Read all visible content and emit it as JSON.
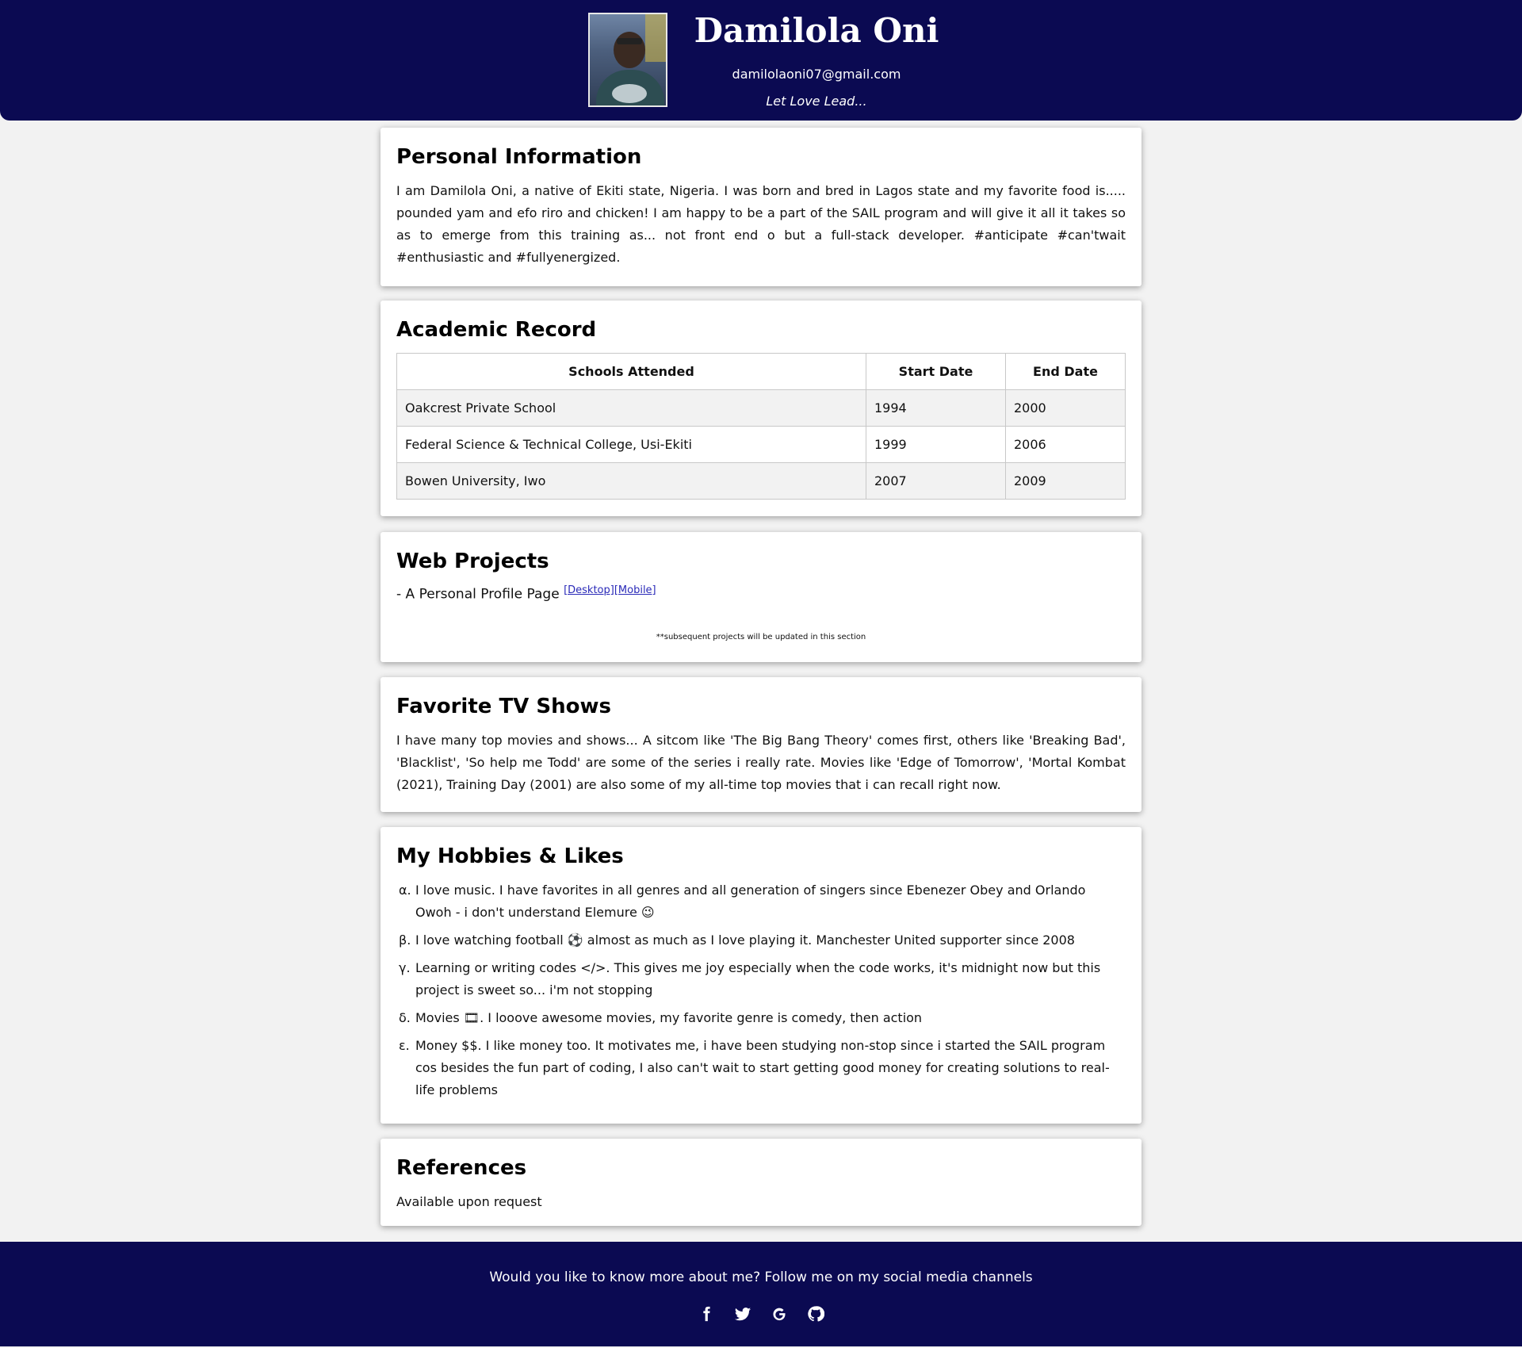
{
  "header": {
    "name": "Damilola Oni",
    "email": "damilolaoni07@gmail.com",
    "tagline": "Let Love Lead..."
  },
  "personal": {
    "title": "Personal Information",
    "text": "I am Damilola Oni, a native of Ekiti state, Nigeria. I was born and bred in Lagos state and my favorite food is..... pounded yam and efo riro and chicken! I am happy to be a part of the SAIL program and will give it all it takes so as to emerge from this training as... not front end o but a full-stack developer. #anticipate #can'twait #enthusiastic and #fullyenergized."
  },
  "academic": {
    "title": "Academic Record",
    "headers": [
      "Schools Attended",
      "Start Date",
      "End Date"
    ],
    "rows": [
      [
        "Oakcrest Private School",
        "1994",
        "2000"
      ],
      [
        "Federal Science & Technical College, Usi-Ekiti",
        "1999",
        "2006"
      ],
      [
        "Bowen University, Iwo",
        "2007",
        "2009"
      ]
    ]
  },
  "projects": {
    "title": "Web Projects",
    "item": "- A Personal Profile Page",
    "link_desktop": "[Desktop]",
    "link_mobile": "[Mobile]",
    "note": "**subsequent projects will be updated in this section"
  },
  "tvshows": {
    "title": "Favorite TV Shows",
    "text": "I have many top movies and shows... A sitcom like 'The Big Bang Theory' comes first, others like 'Breaking Bad', 'Blacklist', 'So help me Todd' are some of the series i really rate. Movies like 'Edge of Tomorrow', 'Mortal Kombat (2021), Training Day (2001) are also some of my all-time top movies that i can recall right now."
  },
  "hobbies": {
    "title": "My Hobbies & Likes",
    "items": [
      {
        "marker": "α.",
        "text": "I love music. I have favorites in all genres and all generation of singers since Ebenezer Obey and Orlando Owoh - i don't understand Elemure 😉"
      },
      {
        "marker": "β.",
        "text": "I love watching football ⚽ almost as much as I love playing it. Manchester United supporter since 2008"
      },
      {
        "marker": "γ.",
        "text": "Learning or writing codes </>. This gives me joy especially when the code works, it's midnight now but this project is sweet so... i'm not stopping"
      },
      {
        "marker": "δ.",
        "text": "Movies 🎞. I looove awesome movies, my favorite genre is comedy, then action"
      },
      {
        "marker": "ε.",
        "text": "Money $$. I like money too. It motivates me, i have been studying non-stop since i started the SAIL program cos besides the fun part of coding, I also can't wait to start getting good money for creating solutions to real-life problems"
      }
    ]
  },
  "references": {
    "title": "References",
    "text": "Available upon request"
  },
  "footer": {
    "text": "Would you like to know more about me? Follow me on my social media channels",
    "icons": [
      "facebook-icon",
      "twitter-icon",
      "google-icon",
      "github-icon"
    ]
  },
  "colors": {
    "navy": "#0b0a52",
    "background": "#f2f2f2",
    "link": "#2a2ab8"
  }
}
